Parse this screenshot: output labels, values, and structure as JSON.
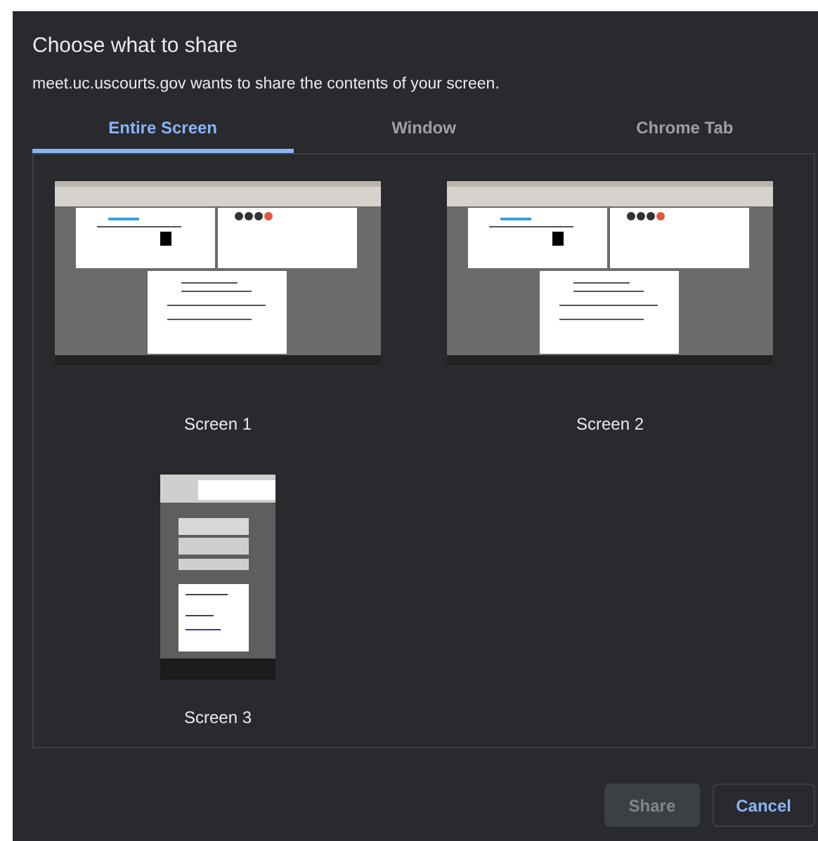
{
  "dialog": {
    "title": "Choose what to share",
    "message": "meet.uc.uscourts.gov wants to share the contents of your screen."
  },
  "tabs": [
    {
      "label": "Entire Screen",
      "selected": true
    },
    {
      "label": "Window",
      "selected": false
    },
    {
      "label": "Chrome Tab",
      "selected": false
    }
  ],
  "sources": [
    {
      "label": "Screen 1",
      "kind": "landscape"
    },
    {
      "label": "Screen 2",
      "kind": "landscape"
    },
    {
      "label": "Screen 3",
      "kind": "portrait"
    }
  ],
  "buttons": [
    {
      "label": "Share",
      "disabled": true
    },
    {
      "label": "Cancel",
      "disabled": false
    }
  ]
}
